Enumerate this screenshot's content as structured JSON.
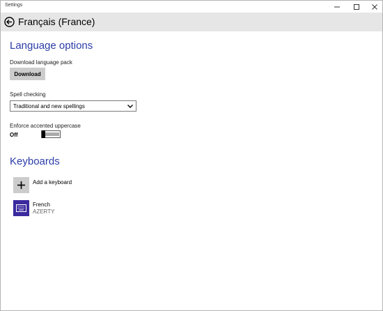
{
  "window": {
    "title": "Settings"
  },
  "header": {
    "title": "Français (France)"
  },
  "language_options": {
    "heading": "Language options",
    "download_pack_label": "Download language pack",
    "download_button": "Download",
    "spell_checking_label": "Spell checking",
    "spell_checking_value": "Traditional and new spellings",
    "enforce_label": "Enforce accented uppercase",
    "enforce_state": "Off"
  },
  "keyboards": {
    "heading": "Keyboards",
    "add_label": "Add a keyboard",
    "items": [
      {
        "name": "French",
        "layout": "AZERTY"
      }
    ]
  },
  "colors": {
    "accent": "#2b3ca8",
    "keyboard_icon_bg": "#3b2a9e",
    "header_bg": "#e6e6e6",
    "button_bg": "#cccccc"
  },
  "icons": {
    "back": "back-arrow-icon",
    "minimize": "minimize-icon",
    "maximize": "maximize-icon",
    "close": "close-icon",
    "add": "plus-icon",
    "keyboard": "keyboard-icon",
    "dropdown": "chevron-down-icon"
  }
}
